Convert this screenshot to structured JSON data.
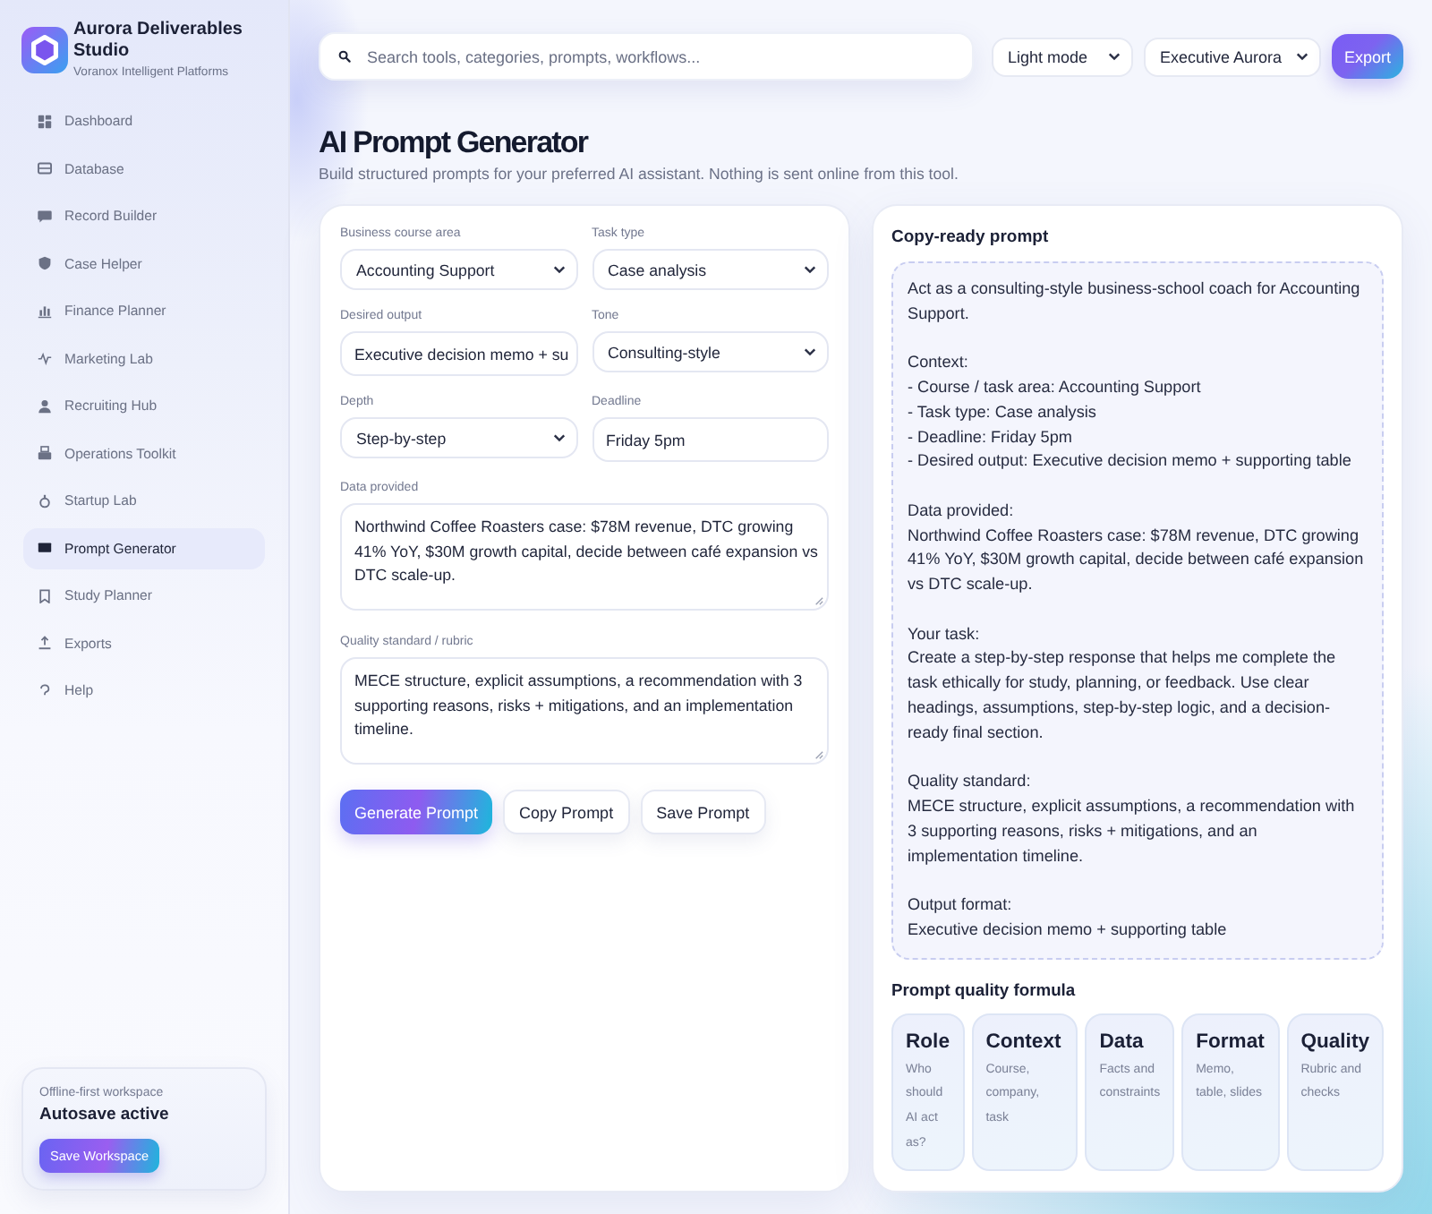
{
  "sidebar": {
    "brand": {
      "title": "Aurora Deliverables Studio",
      "subtitle": "Voranox Intelligent Platforms"
    },
    "items": [
      {
        "label": "Dashboard",
        "selected": false
      },
      {
        "label": "Database",
        "selected": false
      },
      {
        "label": "Record Builder",
        "selected": false
      },
      {
        "label": "Case Helper",
        "selected": false
      },
      {
        "label": "Finance Planner",
        "selected": false
      },
      {
        "label": "Marketing Lab",
        "selected": false
      },
      {
        "label": "Recruiting Hub",
        "selected": false
      },
      {
        "label": "Operations Toolkit",
        "selected": false
      },
      {
        "label": "Startup Lab",
        "selected": false
      },
      {
        "label": "Prompt Generator",
        "selected": true
      },
      {
        "label": "Study Planner",
        "selected": false
      },
      {
        "label": "Exports",
        "selected": false
      },
      {
        "label": "Help",
        "selected": false
      }
    ],
    "status_card": {
      "caption": "Offline-first workspace",
      "title": "Autosave active",
      "button": "Save Workspace"
    }
  },
  "toolbar": {
    "search": {
      "placeholder": "Search tools, categories, prompts, workflows..."
    },
    "selects": [
      "Light mode",
      "Executive Aurora"
    ],
    "export_button": "Export"
  },
  "page": {
    "title": "AI Prompt Generator",
    "subtitle": "Build structured prompts for your preferred AI assistant. Nothing is sent online from this tool."
  },
  "form": {
    "fields": [
      {
        "kind": "select",
        "label": "Business course area",
        "value": "Accounting Support"
      },
      {
        "kind": "select",
        "label": "Task type",
        "value": "Case analysis"
      },
      {
        "kind": "input",
        "label": "Desired output",
        "value": "Executive decision memo + su"
      },
      {
        "kind": "select",
        "label": "Tone",
        "value": "Consulting-style"
      },
      {
        "kind": "select",
        "label": "Depth",
        "value": "Step-by-step"
      },
      {
        "kind": "input",
        "label": "Deadline",
        "value": "Friday 5pm"
      },
      {
        "kind": "textarea",
        "label": "Data provided",
        "value": "Northwind Coffee Roasters case: $78M revenue, DTC growing 41% YoY, $30M growth capital, decide between café expansion vs DTC scale-up."
      },
      {
        "kind": "textarea",
        "label": "Quality standard / rubric",
        "value": "MECE structure, explicit assumptions, a recommendation with 3 supporting reasons, risks + mitigations, and an implementation timeline."
      }
    ],
    "buttons": [
      {
        "kind": "primary",
        "label": "Generate Prompt"
      },
      {
        "kind": "secondary",
        "label": "Copy Prompt"
      },
      {
        "kind": "secondary",
        "label": "Save Prompt"
      }
    ]
  },
  "output": {
    "title": "Copy-ready prompt",
    "text": "Act as a consulting-style business-school coach for Accounting Support.\n\nContext:\n- Course / task area: Accounting Support\n- Task type: Case analysis\n- Deadline: Friday 5pm\n- Desired output: Executive decision memo + supporting table\n\nData provided:\nNorthwind Coffee Roasters case: $78M revenue, DTC growing 41% YoY, $30M growth capital, decide between café expansion vs DTC scale-up.\n\nYour task:\nCreate a step-by-step response that helps me complete the task ethically for study, planning, or feedback. Use clear headings, assumptions, step-by-step logic, and a decision-ready final section.\n\nQuality standard:\nMECE structure, explicit assumptions, a recommendation with 3 supporting reasons, risks + mitigations, and an implementation timeline.\n\nOutput format:\nExecutive decision memo + supporting table",
    "formula": {
      "title": "Prompt quality formula",
      "items": [
        {
          "title": "Role",
          "description": "Who should AI act as?"
        },
        {
          "title": "Context",
          "description": "Course, company, task"
        },
        {
          "title": "Data",
          "description": "Facts and constraints"
        },
        {
          "title": "Format",
          "description": "Memo, table, slides"
        },
        {
          "title": "Quality",
          "description": "Rubric and checks"
        }
      ]
    }
  }
}
